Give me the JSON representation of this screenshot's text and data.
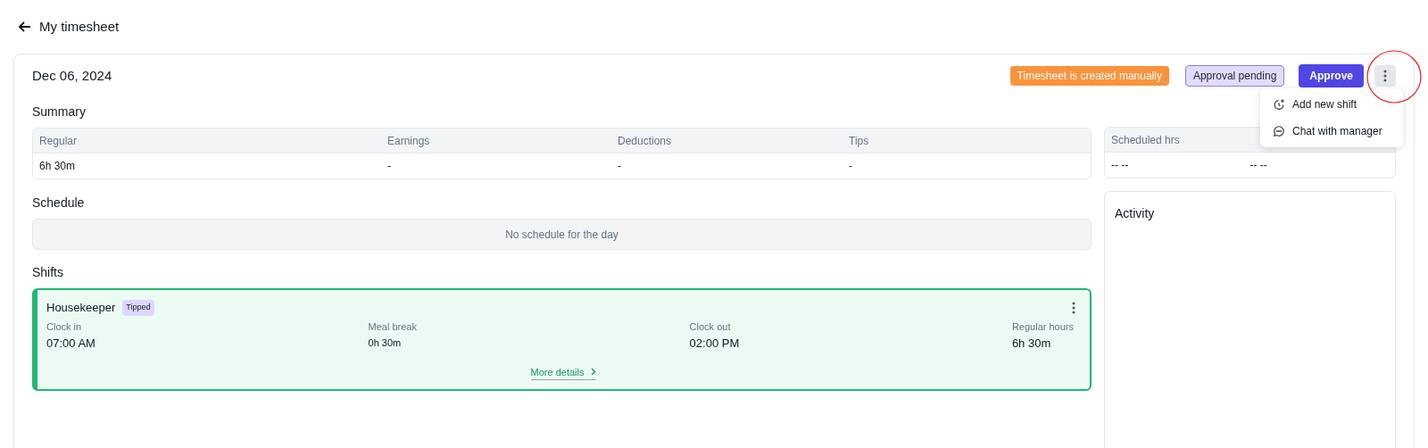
{
  "header": {
    "back_label": "My timesheet"
  },
  "card": {
    "date": "Dec 06, 2024",
    "badges": [
      {
        "label": "Timesheet is created manually",
        "kind": "warning"
      },
      {
        "label": "Approval pending",
        "kind": "pending"
      }
    ],
    "approve_button": "Approve",
    "menu": {
      "open": true,
      "items": [
        {
          "label": "Add new shift",
          "kind": "add-shift"
        },
        {
          "label": "Chat with manager",
          "kind": "chat"
        }
      ]
    },
    "summary": {
      "title": "Summary",
      "columns": [
        "Regular",
        "Earnings",
        "Deductions",
        "Tips"
      ],
      "values": [
        "6h 30m",
        "-",
        "-",
        "-"
      ]
    },
    "schedule": {
      "title": "Schedule",
      "empty_text": "No schedule for the day"
    },
    "shifts": {
      "title": "Shifts",
      "items": [
        {
          "role": "Housekeeper",
          "tag": "Tipped",
          "fields": [
            {
              "label": "Clock in",
              "value": "07:00 AM"
            },
            {
              "label": "Meal break",
              "value": "0h 30m",
              "kind": "small"
            },
            {
              "label": "Clock out",
              "value": "02:00 PM"
            },
            {
              "label": "Regular hours",
              "value": "6h 30m"
            }
          ],
          "link": "More details"
        }
      ]
    },
    "scheduled_table": {
      "columns": [
        "Scheduled hrs"
      ],
      "values": [
        "-- --",
        "-- --"
      ]
    },
    "activity": {
      "title": "Activity"
    }
  }
}
